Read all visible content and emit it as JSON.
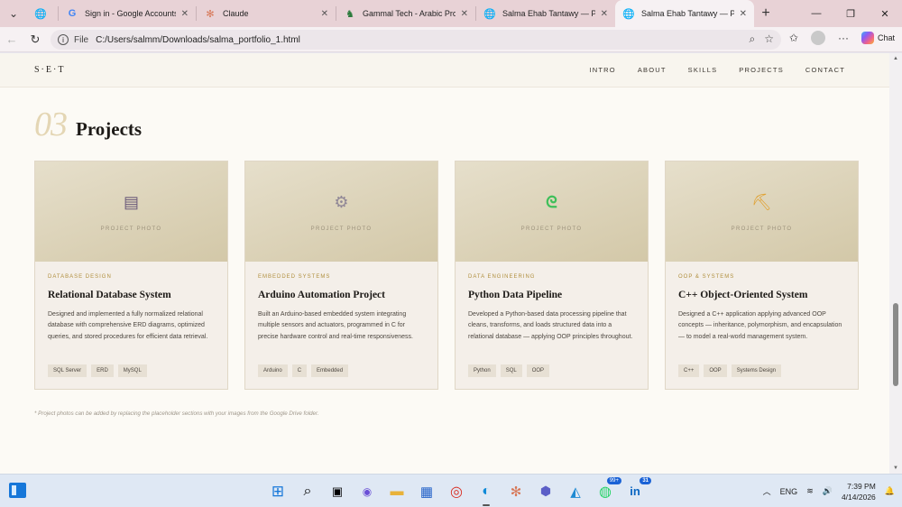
{
  "browser": {
    "tabs": [
      {
        "label": "Sign in - Google Accounts",
        "icon": "google-icon",
        "active": false
      },
      {
        "label": "Claude",
        "icon": "claude-icon",
        "active": false
      },
      {
        "label": "Gammal Tech - Arabic Progra",
        "icon": "gammal-icon",
        "active": false
      },
      {
        "label": "Salma Ehab Tantawy — Portf",
        "icon": "globe-icon",
        "active": false
      },
      {
        "label": "Salma Ehab Tantawy — Portf",
        "icon": "globe-icon",
        "active": true
      }
    ],
    "address": {
      "scheme": "File",
      "url": "C:/Users/salmm/Downloads/salma_portfolio_1.html"
    },
    "chat_label": "Chat"
  },
  "site": {
    "brand": "S·E·T",
    "nav": [
      "INTRO",
      "ABOUT",
      "SKILLS",
      "PROJECTS",
      "CONTACT"
    ],
    "section_number": "03",
    "section_title": "Projects",
    "photo_label": "PROJECT PHOTO",
    "projects": [
      {
        "category": "DATABASE DESIGN",
        "title": "Relational Database System",
        "description": "Designed and implemented a fully normalized relational database with comprehensive ERD diagrams, optimized queries, and stored procedures for efficient data retrieval.",
        "tags": [
          "SQL Server",
          "ERD",
          "MySQL"
        ],
        "icon": "filing-cabinet-icon",
        "icon_color": "#6b5a7a"
      },
      {
        "category": "EMBEDDED SYSTEMS",
        "title": "Arduino Automation Project",
        "description": "Built an Arduino-based embedded system integrating multiple sensors and actuators, programmed in C for precise hardware control and real-time responsiveness.",
        "tags": [
          "Arduino",
          "C",
          "Embedded"
        ],
        "icon": "gear-icon",
        "icon_color": "#8f8696"
      },
      {
        "category": "DATA ENGINEERING",
        "title": "Python Data Pipeline",
        "description": "Developed a Python-based data processing pipeline that cleans, transforms, and loads structured data into a relational database — applying OOP principles throughout.",
        "tags": [
          "Python",
          "SQL",
          "OOP"
        ],
        "icon": "snake-icon",
        "icon_color": "#3fbf5a"
      },
      {
        "category": "OOP & SYSTEMS",
        "title": "C++ Object-Oriented System",
        "description": "Designed a C++ application applying advanced OOP concepts — inheritance, polymorphism, and encapsulation — to model a real-world management system.",
        "tags": [
          "C++",
          "OOP",
          "Systems Design"
        ],
        "icon": "crane-icon",
        "icon_color": "#e0a030"
      }
    ],
    "footnote": "* Project photos can be added by replacing the placeholder sections with your images from the Google Drive folder."
  },
  "taskbar": {
    "apps": [
      {
        "icon": "windows-start-icon"
      },
      {
        "icon": "search-icon"
      },
      {
        "icon": "task-view-icon"
      },
      {
        "icon": "copilot-icon"
      },
      {
        "icon": "file-explorer-icon"
      },
      {
        "icon": "microsoft-store-icon"
      },
      {
        "icon": "chrome-icon"
      },
      {
        "icon": "edge-icon"
      },
      {
        "icon": "claude-icon"
      },
      {
        "icon": "teams-icon"
      },
      {
        "icon": "vscode-icon"
      },
      {
        "icon": "whatsapp-icon",
        "badge": "99+"
      },
      {
        "icon": "linkedin-icon",
        "badge": "31"
      }
    ],
    "language": "ENG",
    "time": "7:39 PM",
    "date": "4/14/2026"
  },
  "colors": {
    "tab_strip": "#e8d2d6",
    "page_bg": "#fcfaf5",
    "accent_gold": "#b08f3e",
    "section_number": "#e4d6b4",
    "taskbar": "#dfe8f4"
  }
}
